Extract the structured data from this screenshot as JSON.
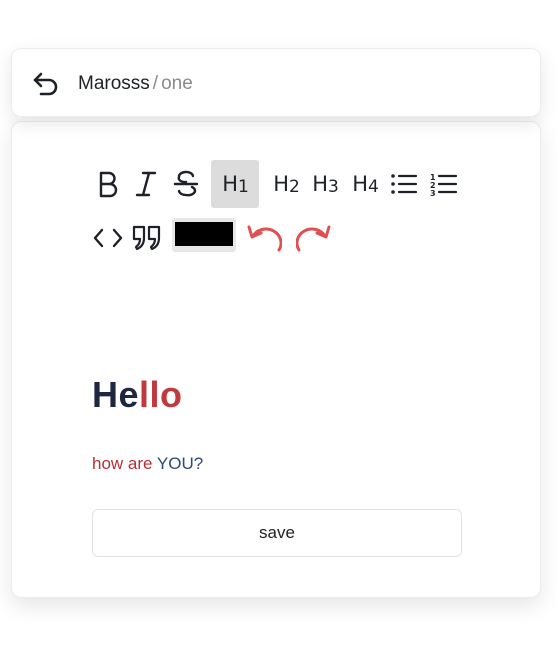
{
  "breadcrumb": {
    "root": "Marosss",
    "separator": "/",
    "current": "one"
  },
  "toolbar": {
    "h1_label": "H",
    "h1_num": "1",
    "h2_label": "H",
    "h2_num": "2",
    "h3_label": "H",
    "h3_num": "3",
    "h4_label": "H",
    "h4_num": "4",
    "active_item": "heading-1",
    "text_color": "#000000",
    "undo_redo_color": "#e05050",
    "icons": [
      "bold-icon",
      "italic-icon",
      "strikethrough-icon",
      "bullet-list-icon",
      "ordered-list-icon",
      "code-icon",
      "quote-icon",
      "undo-icon",
      "redo-icon"
    ]
  },
  "content": {
    "heading_part1": "He",
    "heading_part2": "llo",
    "paragraph_part1": "how are ",
    "paragraph_part2": "YOU?"
  },
  "actions": {
    "save_label": "save"
  },
  "colors": {
    "heading": "#1e2640",
    "highlight_red": "#c0393d",
    "paragraph_red": "#b3303a",
    "paragraph_blue": "#2d4a7a"
  }
}
